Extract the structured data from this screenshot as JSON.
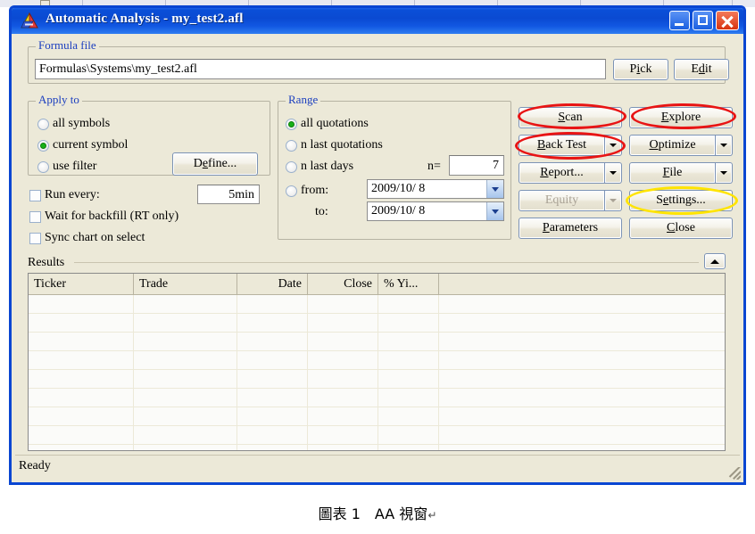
{
  "window": {
    "title": "Automatic Analysis - my_test2.afl",
    "app_icon": "amibroker-logo-icon",
    "titlebar_buttons": [
      {
        "name": "minimize-button",
        "icon": "minimize-icon"
      },
      {
        "name": "maximize-button",
        "icon": "maximize-icon"
      },
      {
        "name": "close-button",
        "icon": "close-icon"
      }
    ],
    "colors": {
      "titlebar": "#0a4ad2",
      "client": "#ece9d8",
      "group_label": "#1c3fbf",
      "annotation_red": "#e81414",
      "annotation_yellow": "#ffe400",
      "radio_selected": "#17b117"
    }
  },
  "formula_file": {
    "group_label": "Formula file",
    "path_value": "Formulas\\Systems\\my_test2.afl",
    "pick_button": "Pick",
    "edit_button": "Edit"
  },
  "apply_to": {
    "group_label": "Apply to",
    "options": [
      {
        "label": "all symbols",
        "selected": false
      },
      {
        "label": "current symbol",
        "selected": true
      },
      {
        "label": "use filter",
        "selected": false
      }
    ],
    "define_button": "Define..."
  },
  "options": {
    "run_every": {
      "label": "Run every:",
      "checked": false,
      "value": "5min"
    },
    "wait_for_backfill": {
      "label": "Wait for backfill (RT only)",
      "checked": false
    },
    "sync_chart_on_select": {
      "label": "Sync chart on select",
      "checked": false
    }
  },
  "range": {
    "group_label": "Range",
    "options": [
      {
        "label": "all quotations",
        "selected": true
      },
      {
        "label": "n last quotations",
        "selected": false
      },
      {
        "label": "n last days",
        "selected": false
      },
      {
        "label": "from:",
        "selected": false
      }
    ],
    "n_label": "n=",
    "n_value": "7",
    "to_label": "to:",
    "from_date": "2009/10/ 8",
    "to_date": "2009/10/ 8"
  },
  "actions": {
    "scan": {
      "label": "Scan",
      "accel": "S",
      "split": false,
      "disabled": false,
      "highlight": "red"
    },
    "explore": {
      "label": "Explore",
      "accel": "E",
      "split": false,
      "disabled": false,
      "highlight": "red"
    },
    "back_test": {
      "label": "Back Test",
      "accel": "B",
      "split": true,
      "disabled": false,
      "highlight": "red"
    },
    "optimize": {
      "label": "Optimize",
      "accel": "O",
      "split": true,
      "disabled": false,
      "highlight": "none"
    },
    "report": {
      "label": "Report...",
      "accel": "R",
      "split": true,
      "disabled": false,
      "highlight": "none"
    },
    "file": {
      "label": "File",
      "accel": "F",
      "split": true,
      "disabled": false,
      "highlight": "none"
    },
    "equity": {
      "label": "Equity",
      "accel": "E",
      "split": true,
      "disabled": true,
      "highlight": "none"
    },
    "settings": {
      "label": "Settings...",
      "accel": "e",
      "split": false,
      "disabled": false,
      "highlight": "yellow"
    },
    "parameters": {
      "label": "Parameters",
      "accel": "P",
      "split": false,
      "disabled": false,
      "highlight": "none"
    },
    "close": {
      "label": "Close",
      "accel": "C",
      "split": false,
      "disabled": false,
      "highlight": "none"
    }
  },
  "results": {
    "label": "Results",
    "collapse_icon": "collapse-up-icon",
    "columns": [
      "Ticker",
      "Trade",
      "Date",
      "Close",
      "% Yi..."
    ],
    "rows": [],
    "empty_row_count": 9
  },
  "status_bar": {
    "text": "Ready"
  },
  "caption": {
    "text": "圖表 1　AA 視窗",
    "paragraph_mark": "↵"
  }
}
